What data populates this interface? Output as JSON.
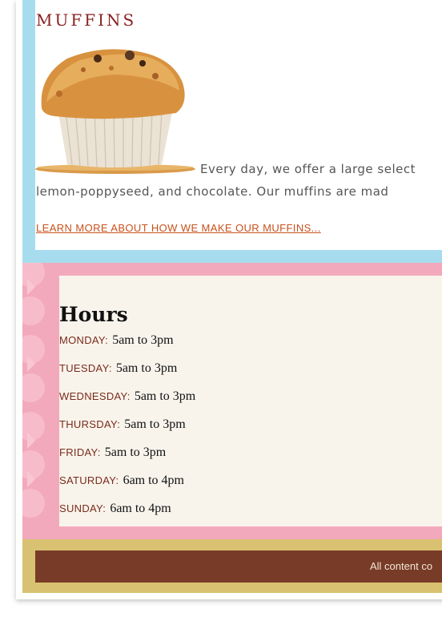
{
  "muffins": {
    "title": "MUFFINS",
    "paragraph_line1": "Every day, we offer a large select",
    "paragraph_line2": "lemon-poppyseed, and chocolate. Our muffins are mad",
    "learn_more_link": "LEARN MORE ABOUT HOW WE MAKE OUR MUFFINS..."
  },
  "hours": {
    "title": "Hours",
    "days": [
      {
        "day": "MONDAY:",
        "time": "5am to 3pm"
      },
      {
        "day": "TUESDAY:",
        "time": "5am to 3pm"
      },
      {
        "day": "WEDNESDAY:",
        "time": "5am to 3pm"
      },
      {
        "day": "THURSDAY:",
        "time": "5am to 3pm"
      },
      {
        "day": "FRIDAY:",
        "time": "5am to 3pm"
      },
      {
        "day": "SATURDAY:",
        "time": "6am to 4pm"
      },
      {
        "day": "SUNDAY:",
        "time": "6am to 4pm"
      }
    ]
  },
  "footer": {
    "text": "All content co"
  },
  "colors": {
    "muffins_border": "#a7dcef",
    "hours_border": "#f3a9bc",
    "footer_border": "#d8c170",
    "footer_bar": "#783b28",
    "title_red": "#8a1f1f",
    "link_orange": "#c8511c"
  }
}
